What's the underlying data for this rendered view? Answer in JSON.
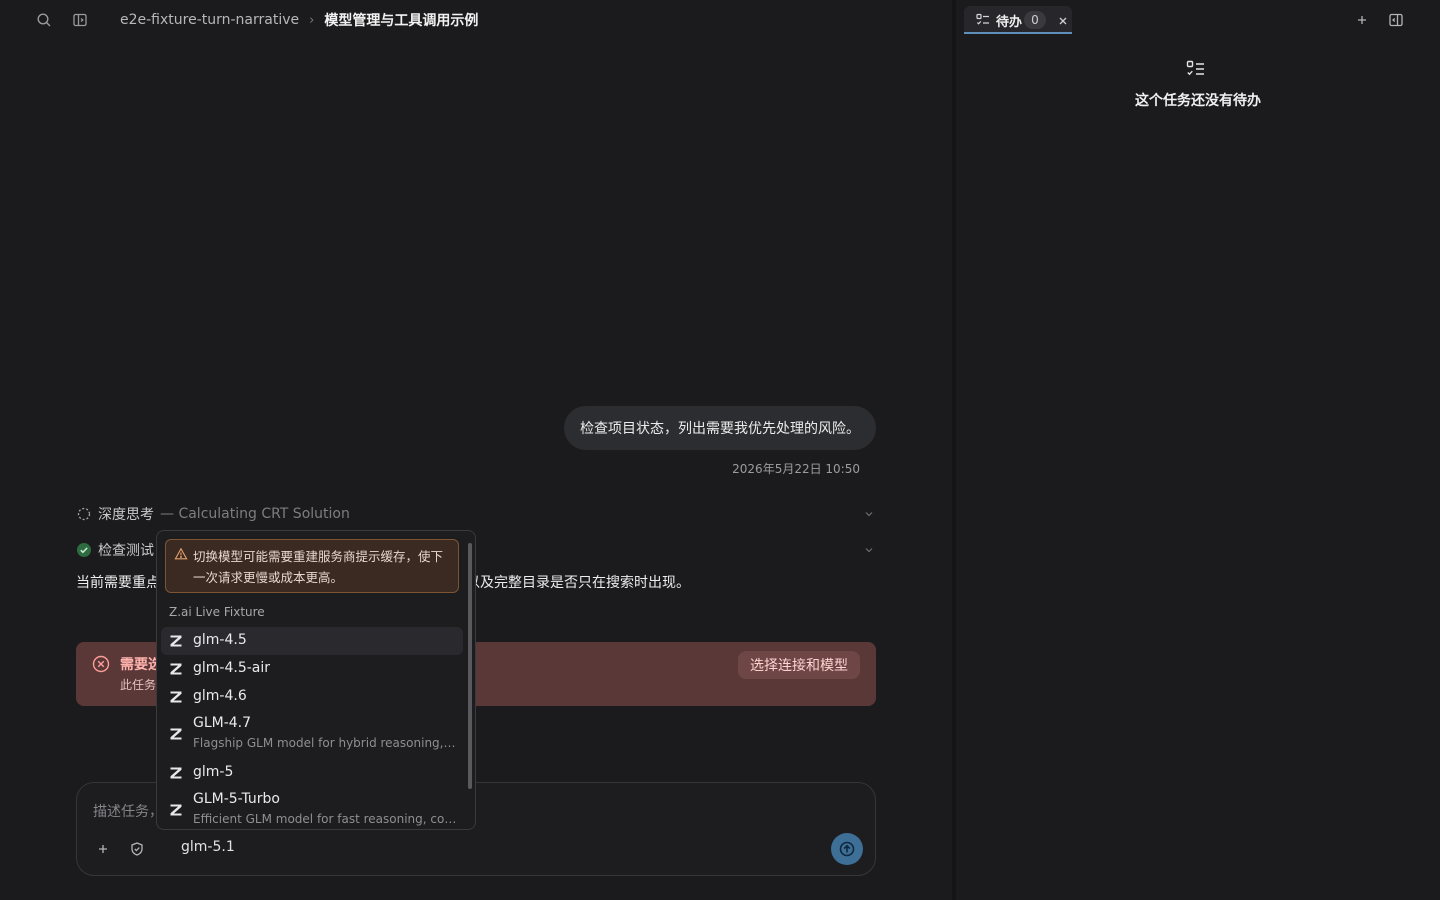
{
  "header": {
    "project": "e2e-fixture-turn-narrative",
    "separator": "›",
    "title": "模型管理与工具调用示例"
  },
  "conversation": {
    "user_message": "检查项目状态，列出需要我优先处理的风险。",
    "timestamp": "2026年5月22日 10:50",
    "thinking_label": "深度思考",
    "thinking_detail": "— Calculating CRT Solution",
    "tool_label": "检查测试",
    "answer_start": "当前需要重点",
    "answer_end": "以及完整目录是否只在搜索时出现。"
  },
  "error": {
    "title": "需要选",
    "subtitle": "此任务",
    "action_label": "选择连接和模型"
  },
  "composer": {
    "placeholder": "描述任务，",
    "current_model": "glm-5.1"
  },
  "model_dropdown": {
    "warning": "切换模型可能需要重建服务商提示缓存，使下一次请求更慢或成本更高。",
    "group_label": "Z.ai Live Fixture",
    "models": [
      {
        "name": "glm-4.5",
        "desc": ""
      },
      {
        "name": "glm-4.5-air",
        "desc": ""
      },
      {
        "name": "glm-4.6",
        "desc": ""
      },
      {
        "name": "GLM-4.7",
        "desc": "Flagship GLM model for hybrid reasoning, c..."
      },
      {
        "name": "glm-5",
        "desc": ""
      },
      {
        "name": "GLM-5-Turbo",
        "desc": "Efficient GLM model for fast reasoning, codi..."
      }
    ]
  },
  "right_panel": {
    "tab_label": "待办",
    "tab_count": "0",
    "empty_message": "这个任务还没有待办"
  },
  "colors": {
    "accent": "#5e8fba",
    "send_button": "#3d6f97",
    "error_bg": "#5b3838",
    "warning_border": "#7c5535",
    "success": "#3f9a57"
  }
}
